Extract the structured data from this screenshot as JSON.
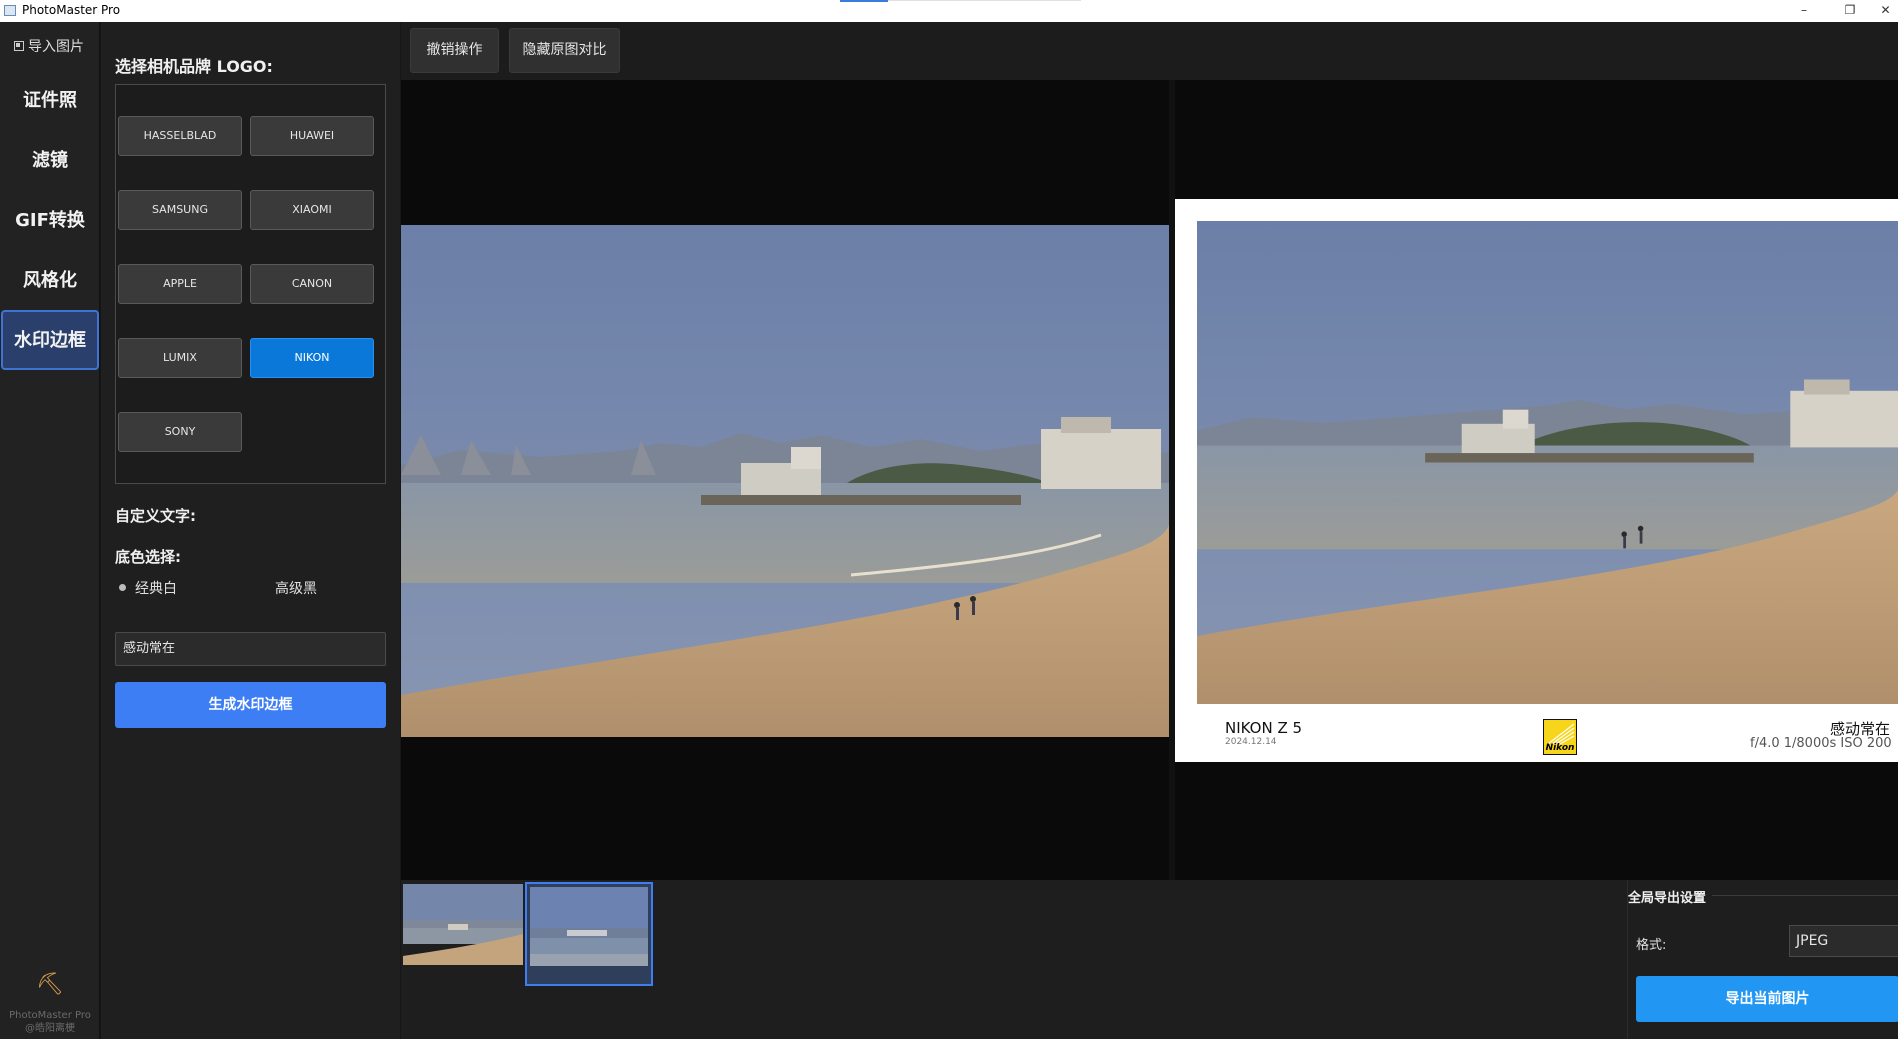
{
  "window": {
    "title": "PhotoMaster Pro",
    "controls": [
      "–",
      "❐",
      "✕"
    ]
  },
  "sidebar": {
    "import_label": "导入图片",
    "items": [
      {
        "label": "证件照",
        "active": false
      },
      {
        "label": "滤镜",
        "active": false
      },
      {
        "label": "GIF转换",
        "active": false
      },
      {
        "label": "风格化",
        "active": false
      },
      {
        "label": "水印边框",
        "active": true
      }
    ],
    "footer_icon": "hammer-icon",
    "credit_line1": "PhotoMaster Pro",
    "credit_line2": "@皓阳离梗"
  },
  "toolbar": {
    "undo_label": "撤销操作",
    "hide_compare_label": "隐藏原图对比"
  },
  "panel": {
    "logo_heading": "选择相机品牌 LOGO:",
    "brands": [
      "HASSELBLAD",
      "HUAWEI",
      "SAMSUNG",
      "XIAOMI",
      "APPLE",
      "CANON",
      "LUMIX",
      "NIKON",
      "SONY"
    ],
    "selected_brand": "NIKON",
    "custom_text_heading": "自定义文字:",
    "bg_heading": "底色选择:",
    "bg_options": [
      "经典白",
      "高级黑"
    ],
    "bg_selected": "经典白",
    "custom_text_value": "感动常在",
    "generate_label": "生成水印边框"
  },
  "watermark": {
    "camera": "NIKON Z 5",
    "date": "2024.12.14",
    "brand_logo_text": "Nikon",
    "custom_text": "感动常在",
    "params": "f/4.0  1/8000s  ISO 200"
  },
  "export": {
    "group_title": "全局导出设置",
    "format_label": "格式:",
    "format_value": "JPEG",
    "export_label": "导出当前图片"
  },
  "colors": {
    "accent": "#3e7ef5",
    "selected_brand": "#0a78d8",
    "export_button": "#2196f3",
    "nikon_yellow": "#f7d51a"
  }
}
